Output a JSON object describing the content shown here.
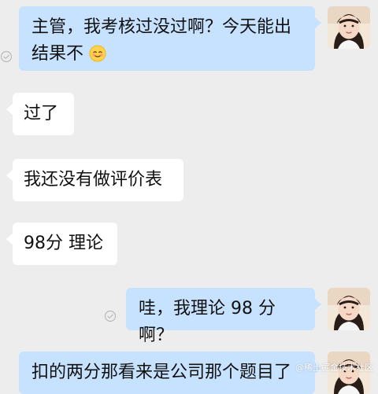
{
  "messages": [
    {
      "side": "outgoing",
      "text_line1": "主管，我考核过没过啊？今天能出",
      "text_line2": "结果不",
      "emoji": "blush-smile-emoji"
    },
    {
      "side": "incoming",
      "text": "过了"
    },
    {
      "side": "incoming",
      "text": "我还没有做评价表"
    },
    {
      "side": "incoming",
      "text": "98分 理论"
    },
    {
      "side": "outgoing",
      "text": "哇，我理论 98 分啊？"
    },
    {
      "side": "outgoing",
      "text": "扣的两分那看来是公司那个题目了"
    }
  ],
  "watermark": "@稀土掘金技术社区",
  "colors": {
    "background": "#ededed",
    "outgoing_bubble": "#c7e2ff",
    "incoming_bubble": "#ffffff"
  }
}
